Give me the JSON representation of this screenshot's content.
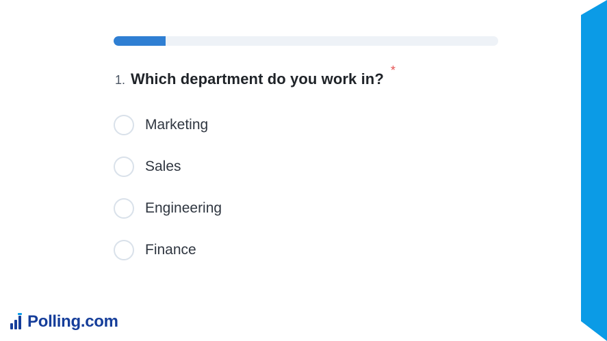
{
  "progress": {
    "value_fraction": 0.135
  },
  "question": {
    "number": "1.",
    "text": "Which department do you work in?",
    "required_marker": "*"
  },
  "options": [
    {
      "label": "Marketing"
    },
    {
      "label": "Sales"
    },
    {
      "label": "Engineering"
    },
    {
      "label": "Finance"
    }
  ],
  "brand": {
    "logo_text": "Polling.com",
    "logo_icon": "bar-chart-icon",
    "accent_color": "#0b9be6",
    "progress_color": "#2f7fd3",
    "logo_color": "#163e9a",
    "required_color": "#e55353"
  }
}
